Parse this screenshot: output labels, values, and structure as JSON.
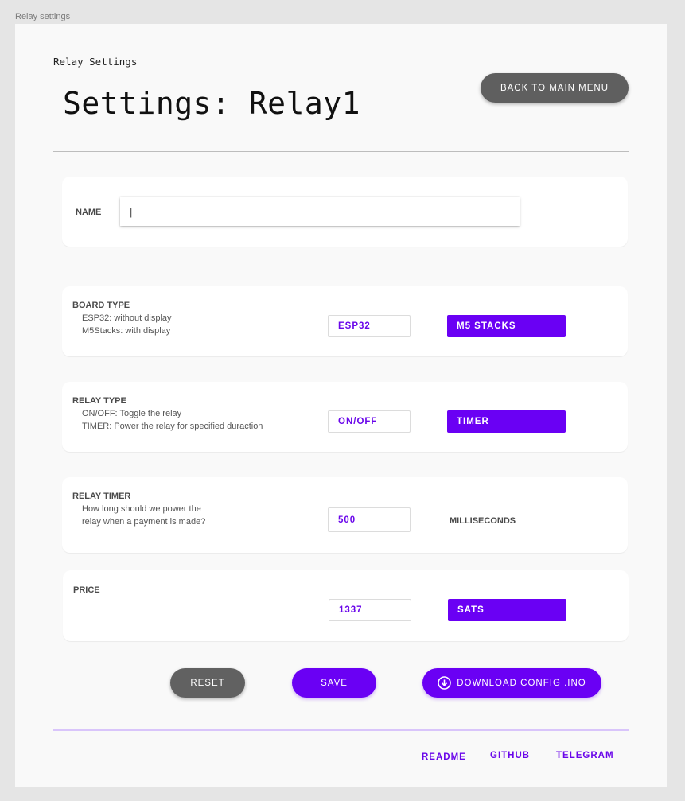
{
  "window": {
    "frame_label": "Relay settings"
  },
  "header": {
    "breadcrumb": "Relay Settings",
    "title": "Settings: Relay1",
    "back_button": "BACK TO MAIN MENU"
  },
  "name_card": {
    "label": "NAME",
    "value": "|"
  },
  "board_type": {
    "title": "BOARD TYPE",
    "desc_1": "ESP32: without display",
    "desc_2": "M5Stacks: with display",
    "selected_value": "ESP32",
    "option_button": "M5 STACKS"
  },
  "relay_type": {
    "title": "RELAY TYPE",
    "desc_1": "ON/OFF: Toggle the relay",
    "desc_2": "TIMER: Power the relay for specified duraction",
    "selected_value": "ON/OFF",
    "option_button": "TIMER"
  },
  "relay_timer": {
    "title": "RELAY TIMER",
    "desc_1": "How long should we power the",
    "desc_2": "relay when a payment is made?",
    "value": "500",
    "unit": "MILLISECONDS"
  },
  "price": {
    "title": "PRICE",
    "value": "1337",
    "unit_button": "SATS"
  },
  "actions": {
    "reset": "RESET",
    "save": "SAVE",
    "download": "DOWNLOAD CONFIG .INO",
    "download_icon": "download-circle-icon"
  },
  "footer": {
    "links": [
      "README",
      "GITHUB",
      "TELEGRAM"
    ]
  },
  "colors": {
    "accent": "#6a00f4",
    "button_gray": "#5f5f5f",
    "footer_line": "#d9c5fb"
  }
}
